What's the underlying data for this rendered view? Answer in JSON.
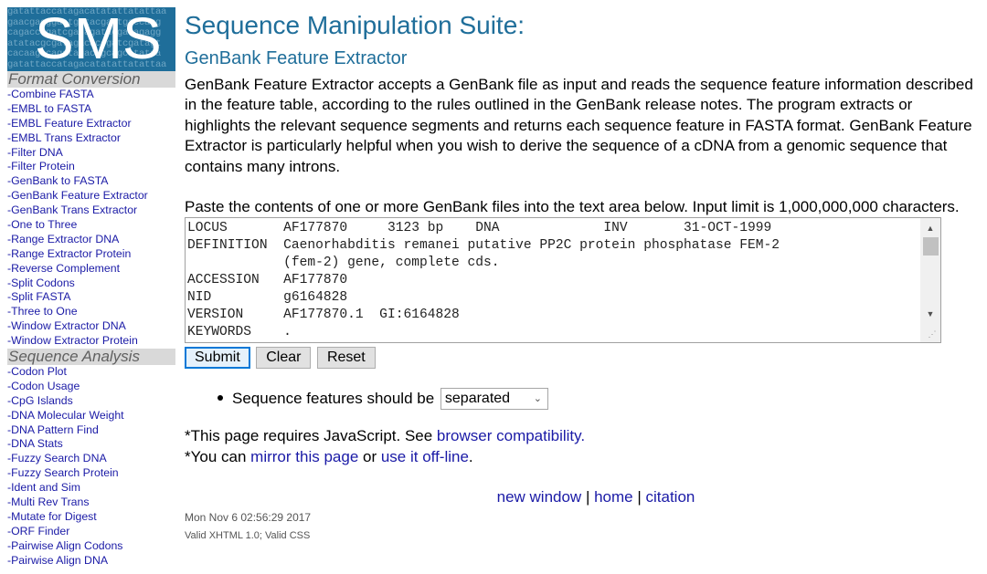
{
  "logo": {
    "text": "SMS",
    "dna_lines": [
      "gatattaccatagacatatattatattaa",
      "gaacgacggaatggtacgagtgaccagg",
      "cagacccgatcgatagatacgatagagg",
      "atatacgcgatagacaccgatcgatagt",
      "cacaagacagatagacagcagcatataa",
      "gatattaccatagacatatattatattaa"
    ]
  },
  "sidebar": {
    "sections": [
      {
        "heading": "Format Conversion",
        "items": [
          "-Combine FASTA",
          "-EMBL to FASTA",
          "-EMBL Feature Extractor",
          "-EMBL Trans Extractor",
          "-Filter DNA",
          "-Filter Protein",
          "-GenBank to FASTA",
          "-GenBank Feature Extractor",
          "-GenBank Trans Extractor",
          "-One to Three",
          "-Range Extractor DNA",
          "-Range Extractor Protein",
          "-Reverse Complement",
          "-Split Codons",
          "-Split FASTA",
          "-Three to One",
          "-Window Extractor DNA",
          "-Window Extractor Protein"
        ]
      },
      {
        "heading": "Sequence Analysis",
        "items": [
          "-Codon Plot",
          "-Codon Usage",
          "-CpG Islands",
          "-DNA Molecular Weight",
          "-DNA Pattern Find",
          "-DNA Stats",
          "-Fuzzy Search DNA",
          "-Fuzzy Search Protein",
          "-Ident and Sim",
          "-Multi Rev Trans",
          "-Mutate for Digest",
          "-ORF Finder",
          "-Pairwise Align Codons",
          "-Pairwise Align DNA"
        ]
      }
    ]
  },
  "main": {
    "title": "Sequence Manipulation Suite:",
    "subtitle": "GenBank Feature Extractor",
    "intro": "GenBank Feature Extractor accepts a GenBank file as input and reads the sequence feature information described in the feature table, according to the rules outlined in the GenBank release notes. The program extracts or highlights the relevant sequence segments and returns each sequence feature in FASTA format. GenBank Feature Extractor is particularly helpful when you wish to derive the sequence of a cDNA from a genomic sequence that contains many introns.",
    "paste_instructions": "Paste the contents of one or more GenBank files into the text area below. Input limit is 1,000,000,000 characters.",
    "sequence_text": "LOCUS       AF177870     3123 bp    DNA             INV       31-OCT-1999\nDEFINITION  Caenorhabditis remanei putative PP2C protein phosphatase FEM-2\n            (fem-2) gene, complete cds.\nACCESSION   AF177870\nNID         g6164828\nVERSION     AF177870.1  GI:6164828\nKEYWORDS    .",
    "buttons": {
      "submit": "Submit",
      "clear": "Clear",
      "reset": "Reset"
    },
    "option": {
      "label": "Sequence features should be",
      "selected": "separated"
    },
    "notes": {
      "js_prefix": "*This page requires JavaScript. See ",
      "js_link": "browser compatibility.",
      "mirror_prefix": "*You can ",
      "mirror_link": "mirror this page",
      "mirror_middle": " or ",
      "offline_link": "use it off-line",
      "mirror_suffix": "."
    },
    "footer": {
      "new_window": "new window",
      "sep1": " | ",
      "home": "home",
      "sep2": " | ",
      "citation": "citation",
      "date": "Mon Nov 6 02:56:29 2017",
      "valid": "Valid XHTML 1.0; Valid CSS"
    }
  },
  "colors": {
    "title": "#1f6e9a",
    "link": "#1a1aa6",
    "sidebar_heading_bg": "#d9d9d9",
    "logo_bg": "#1f6e9a"
  }
}
